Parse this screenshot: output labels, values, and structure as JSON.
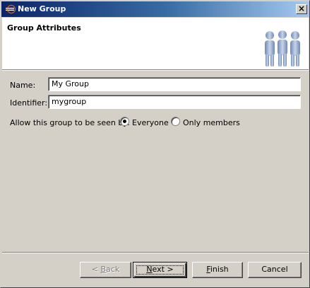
{
  "window": {
    "title": "New Group"
  },
  "banner": {
    "title": "Group Attributes",
    "icon": "group-people-icon"
  },
  "form": {
    "name": {
      "label": "Name:",
      "value": "My Group"
    },
    "identifier": {
      "label": "Identifier:",
      "value": "mygroup"
    },
    "visibility": {
      "label": "Allow this group to be seen by:",
      "options": [
        {
          "label": "Everyone",
          "selected": true
        },
        {
          "label": "Only members",
          "selected": false
        }
      ]
    }
  },
  "buttons": {
    "back": {
      "prefix": "< ",
      "mnemonic": "B",
      "rest": "ack",
      "enabled": false
    },
    "next": {
      "mnemonic": "N",
      "rest": "ext >",
      "enabled": true
    },
    "finish": {
      "mnemonic": "F",
      "rest": "inish",
      "enabled": true
    },
    "cancel": {
      "label": "Cancel",
      "enabled": true
    }
  }
}
